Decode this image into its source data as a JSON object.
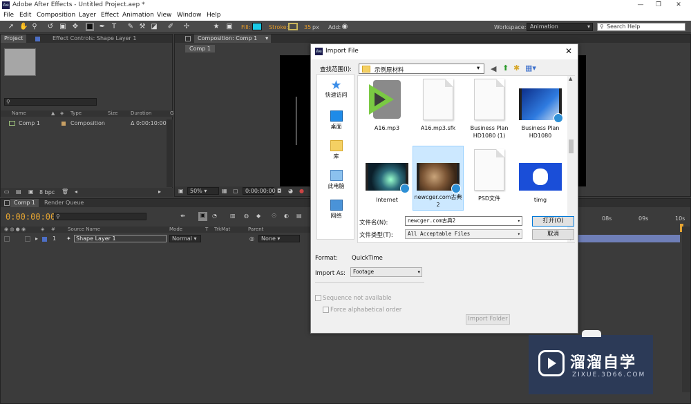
{
  "titlebar": {
    "app_icon": "Ae",
    "title": "Adobe After Effects - Untitled Project.aep *",
    "min": "—",
    "max": "❐",
    "close": "✕"
  },
  "menu": [
    "File",
    "Edit",
    "Composition",
    "Layer",
    "Effect",
    "Animation",
    "View",
    "Window",
    "Help"
  ],
  "toolbar": {
    "fill_label": "Fill:",
    "stroke_label": "Stroke:",
    "stroke_value": "35",
    "stroke_unit": "px",
    "add_label": "Add:",
    "workspace_label": "Workspace:",
    "workspace_value": "Animation",
    "search_placeholder": "Search Help"
  },
  "project": {
    "tabs": [
      "Project",
      "Effect Controls: Shape Layer 1"
    ],
    "columns": [
      "Name",
      "Type",
      "Size",
      "Duration",
      "G"
    ],
    "rows": [
      {
        "name": "Comp 1",
        "type": "Composition",
        "duration": "Δ 0:00:10:00"
      }
    ],
    "bpc": "8 bpc"
  },
  "comp": {
    "tab": "Composition: Comp 1",
    "subtab": "Comp 1",
    "zoom": "50%",
    "time": "0:00:00:00"
  },
  "timeline": {
    "tabs": [
      "Comp 1",
      "Render Queue"
    ],
    "time": "0:00:00:00",
    "columns": {
      "source": "Source Name",
      "mode": "Mode",
      "t": "T",
      "trkmat": "TrkMat",
      "parent": "Parent"
    },
    "layer": {
      "index": "1",
      "name": "Shape Layer 1",
      "mode": "Normal",
      "parent": "None"
    },
    "ruler": [
      "08s",
      "09s",
      "10s"
    ]
  },
  "dialog": {
    "title": "Import File",
    "close": "✕",
    "lookin_label": "查找范围(I):",
    "lookin_value": "示例原材料",
    "places": [
      "快速访问",
      "桌面",
      "库",
      "此电脑",
      "网络"
    ],
    "files": [
      {
        "name": "A16.mp3"
      },
      {
        "name": "A16.mp3.sfk"
      },
      {
        "name": "Business Plan HD1080 (1)"
      },
      {
        "name": "Business Plan HD1080"
      },
      {
        "name": "Internet"
      },
      {
        "name": "newcger.com古典2"
      },
      {
        "name": "PSD文件"
      },
      {
        "name": "timg"
      }
    ],
    "filename_label": "文件名(N):",
    "filename_value": "newcger.com古典2",
    "filetype_label": "文件类型(T):",
    "filetype_value": "All Acceptable Files",
    "open_button": "打开(O)",
    "cancel_button": "取消",
    "format_label": "Format:",
    "format_value": "QuickTime",
    "importas_label": "Import As:",
    "importas_value": "Footage",
    "sequence_label": "Sequence not available",
    "alpha_label": "Force alphabetical order",
    "import_folder_button": "Import Folder"
  },
  "watermark": {
    "title": "溜溜自学",
    "url": "ZIXUE.3D66.COM"
  },
  "colors": {
    "fill": "#19c9e6",
    "accent": "#e49a2a",
    "timecode": "#e3a332"
  }
}
